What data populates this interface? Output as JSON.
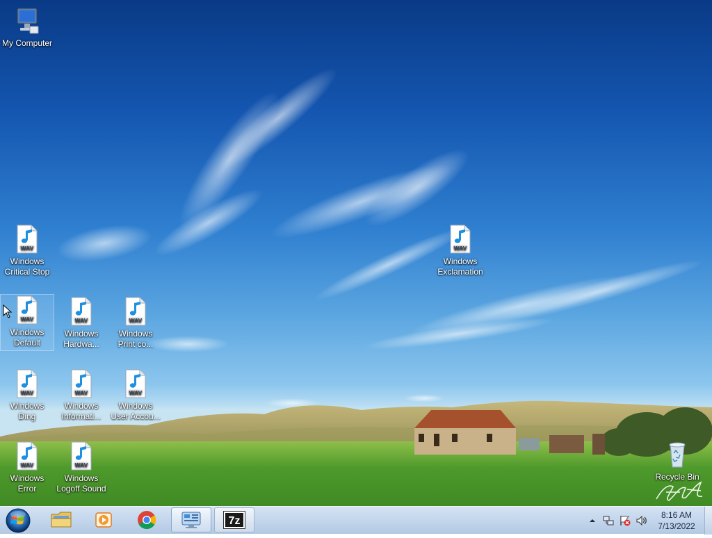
{
  "desktop": {
    "icons": [
      {
        "name": "my-computer",
        "label": "My Computer",
        "type": "computer"
      },
      {
        "name": "windows-critical-stop",
        "label": "Windows Critical Stop",
        "type": "wav"
      },
      {
        "name": "windows-exclamation",
        "label": "Windows Exclamation",
        "type": "wav"
      },
      {
        "name": "windows-default",
        "label": "Windows Default",
        "type": "wav"
      },
      {
        "name": "windows-hardware",
        "label": "Windows Hardwa...",
        "type": "wav"
      },
      {
        "name": "windows-print-complete",
        "label": "Windows Print co...",
        "type": "wav"
      },
      {
        "name": "windows-ding",
        "label": "Windows Ding",
        "type": "wav"
      },
      {
        "name": "windows-information",
        "label": "Windows Informati...",
        "type": "wav"
      },
      {
        "name": "windows-user-account",
        "label": "Windows User Accou...",
        "type": "wav"
      },
      {
        "name": "windows-error",
        "label": "Windows Error",
        "type": "wav"
      },
      {
        "name": "windows-logoff-sound",
        "label": "Windows Logoff Sound",
        "type": "wav"
      },
      {
        "name": "recycle-bin",
        "label": "Recycle Bin",
        "type": "recycle-bin"
      }
    ],
    "wav_badge": "WAV"
  },
  "taskbar": {
    "pinned": [
      {
        "name": "start-button",
        "icon": "windows-orb-icon"
      },
      {
        "name": "explorer-button",
        "icon": "folder-icon"
      },
      {
        "name": "media-player-button",
        "icon": "media-player-icon"
      },
      {
        "name": "chrome-button",
        "icon": "chrome-icon"
      },
      {
        "name": "control-panel-button",
        "icon": "control-panel-icon",
        "active": true
      },
      {
        "name": "7zip-button",
        "icon": "7zip-icon",
        "text": "7z"
      }
    ],
    "tray": {
      "icons": [
        "show-hidden-icons-icon",
        "network-icon",
        "action-center-icon",
        "volume-icon"
      ],
      "time": "8:16 AM",
      "date": "7/13/2022"
    }
  }
}
